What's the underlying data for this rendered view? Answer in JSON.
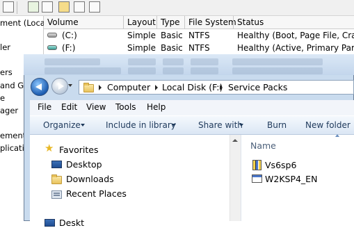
{
  "background_window": {
    "tree_items": [
      "ment (Local",
      "ler",
      "ers",
      "and Gro",
      "e",
      "ager",
      "ement",
      "plicatio"
    ],
    "columns": [
      "Volume",
      "Layout",
      "Type",
      "File System",
      "Status"
    ],
    "volumes": [
      {
        "volume": "(C:)",
        "layout": "Simple",
        "type": "Basic",
        "fs": "NTFS",
        "status": "Healthy (Boot, Page File, Crash I"
      },
      {
        "volume": "(F:)",
        "layout": "Simple",
        "type": "Basic",
        "fs": "NTFS",
        "status": "Healthy (Active, Primary Partitio"
      }
    ]
  },
  "explorer": {
    "address": [
      "Computer",
      "Local Disk (F:)",
      "Service Packs"
    ],
    "menu": [
      "File",
      "Edit",
      "View",
      "Tools",
      "Help"
    ],
    "commands": [
      "Organize",
      "Include in library",
      "Share with",
      "Burn",
      "New folder"
    ],
    "nav": {
      "favorites": "Favorites",
      "items": [
        "Desktop",
        "Downloads",
        "Recent Places"
      ],
      "partial": "Deskt"
    },
    "content": {
      "column_header": "Name",
      "files": [
        "Vs6sp6",
        "W2KSP4_EN"
      ]
    }
  }
}
